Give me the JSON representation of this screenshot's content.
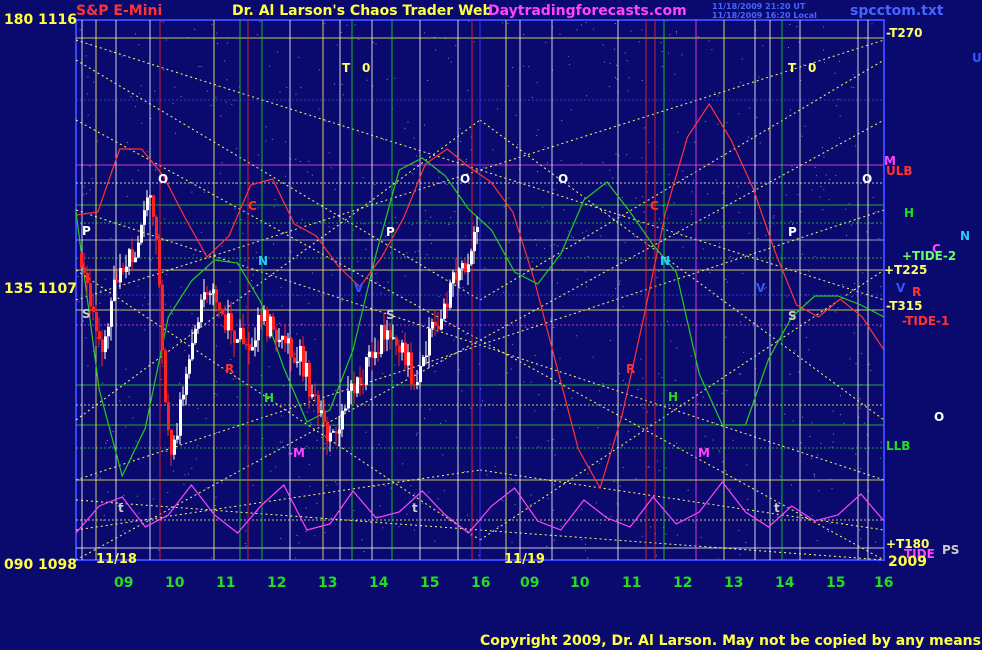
{
  "header": {
    "title_left": "S&P E-Mini",
    "title_center": "Dr. Al Larson's Chaos Trader Web",
    "website": "Daytradingforecasts.com",
    "timestamp1": "11/18/2009 21:20 UT",
    "timestamp2": "11/18/2009 16:20 Local",
    "filename": "spcctom.txt"
  },
  "copyright": "Copyright 2009, Dr. Al Larson. May not be copied by any means.",
  "y_axis": [
    {
      "angle": "180",
      "price": "1116"
    },
    {
      "angle": "135",
      "price": "1107"
    },
    {
      "angle": "090",
      "price": "1098"
    }
  ],
  "x_axis": {
    "hours": [
      {
        "h": "09",
        "x": 122
      },
      {
        "h": "10",
        "x": 173
      },
      {
        "h": "11",
        "x": 224
      },
      {
        "h": "12",
        "x": 275
      },
      {
        "h": "13",
        "x": 326
      },
      {
        "h": "14",
        "x": 377
      },
      {
        "h": "15",
        "x": 428
      },
      {
        "h": "16",
        "x": 479
      },
      {
        "h": "09",
        "x": 528
      },
      {
        "h": "10",
        "x": 578
      },
      {
        "h": "11",
        "x": 630
      },
      {
        "h": "12",
        "x": 681
      },
      {
        "h": "13",
        "x": 732
      },
      {
        "h": "14",
        "x": 783
      },
      {
        "h": "15",
        "x": 834
      },
      {
        "h": "16",
        "x": 882
      }
    ],
    "dates": [
      {
        "label": "11/18",
        "x": 96
      },
      {
        "label": "11/19",
        "x": 504
      }
    ],
    "year": "2009"
  },
  "right_labels": [
    {
      "text": "-T270",
      "color": "#ffff66",
      "x": 886,
      "y": 37
    },
    {
      "text": "M",
      "color": "#ff44ff",
      "x": 884,
      "y": 165
    },
    {
      "text": "ULB",
      "color": "#ff3333",
      "x": 886,
      "y": 175
    },
    {
      "text": "H",
      "color": "#22dd22",
      "x": 904,
      "y": 217
    },
    {
      "text": "N",
      "color": "#22ccff",
      "x": 960,
      "y": 240
    },
    {
      "text": "C",
      "color": "#ff44ff",
      "x": 932,
      "y": 253
    },
    {
      "text": "+TIDE-2",
      "color": "#66ff66",
      "x": 902,
      "y": 260
    },
    {
      "text": "+T225",
      "color": "#ffff66",
      "x": 884,
      "y": 274
    },
    {
      "text": "R",
      "color": "#ff3333",
      "x": 912,
      "y": 296
    },
    {
      "text": "-T315",
      "color": "#ffff66",
      "x": 886,
      "y": 310
    },
    {
      "text": "-TIDE-1",
      "color": "#ff3333",
      "x": 902,
      "y": 325
    },
    {
      "text": "U",
      "color": "#3355ff",
      "x": 972,
      "y": 62
    },
    {
      "text": "O",
      "color": "#ffffff",
      "x": 934,
      "y": 421
    },
    {
      "text": "LLB",
      "color": "#22dd22",
      "x": 886,
      "y": 450
    },
    {
      "text": "+T180",
      "color": "#ffff66",
      "x": 886,
      "y": 548
    },
    {
      "text": "TIDE",
      "color": "#ff44ff",
      "x": 904,
      "y": 558
    },
    {
      "text": "PS",
      "color": "#cccccc",
      "x": 942,
      "y": 554
    },
    {
      "text": "V",
      "color": "#3355ff",
      "x": 896,
      "y": 292
    }
  ],
  "chart_labels": [
    {
      "text": "T",
      "color": "#ffff66",
      "x": 342,
      "y": 72
    },
    {
      "text": "0",
      "color": "#ffff66",
      "x": 362,
      "y": 72
    },
    {
      "text": "T",
      "color": "#ffff66",
      "x": 788,
      "y": 72
    },
    {
      "text": "0",
      "color": "#ffff66",
      "x": 808,
      "y": 72
    },
    {
      "text": "O",
      "color": "#ffffff",
      "x": 158,
      "y": 183
    },
    {
      "text": "O",
      "color": "#ffffff",
      "x": 460,
      "y": 183
    },
    {
      "text": "O",
      "color": "#ffffff",
      "x": 558,
      "y": 183
    },
    {
      "text": "O",
      "color": "#ffffff",
      "x": 862,
      "y": 183
    },
    {
      "text": "C",
      "color": "#ff3333",
      "x": 248,
      "y": 210
    },
    {
      "text": "C",
      "color": "#ff3333",
      "x": 650,
      "y": 210
    },
    {
      "text": "P",
      "color": "#ffffff",
      "x": 82,
      "y": 235
    },
    {
      "text": "P",
      "color": "#ffffff",
      "x": 386,
      "y": 236
    },
    {
      "text": "P",
      "color": "#ffffff",
      "x": 788,
      "y": 236
    },
    {
      "text": "N",
      "color": "#22ccff",
      "x": 258,
      "y": 265
    },
    {
      "text": "N",
      "color": "#22ccff",
      "x": 660,
      "y": 265
    },
    {
      "text": "V",
      "color": "#3355ff",
      "x": 354,
      "y": 292
    },
    {
      "text": "V",
      "color": "#3355ff",
      "x": 756,
      "y": 292
    },
    {
      "text": "S",
      "color": "#cccccc",
      "x": 82,
      "y": 318
    },
    {
      "text": "S",
      "color": "#cccccc",
      "x": 386,
      "y": 319
    },
    {
      "text": "S",
      "color": "#cccccc",
      "x": 788,
      "y": 320
    },
    {
      "text": "R",
      "color": "#ff3333",
      "x": 225,
      "y": 373
    },
    {
      "text": "R",
      "color": "#ff3333",
      "x": 626,
      "y": 373
    },
    {
      "text": "H",
      "color": "#22dd22",
      "x": 264,
      "y": 402
    },
    {
      "text": "H",
      "color": "#22dd22",
      "x": 668,
      "y": 401
    },
    {
      "text": "-M",
      "color": "#ff44ff",
      "x": 288,
      "y": 457
    },
    {
      "text": "M",
      "color": "#ff44ff",
      "x": 698,
      "y": 457
    },
    {
      "text": "t",
      "color": "#cccccc",
      "x": 118,
      "y": 512
    },
    {
      "text": "t",
      "color": "#cccccc",
      "x": 412,
      "y": 512
    },
    {
      "text": "t",
      "color": "#cccccc",
      "x": 774,
      "y": 512
    }
  ],
  "chart_data": {
    "type": "candlestick",
    "instrument": "S&P E-Mini",
    "ylim": [
      1098,
      1116
    ],
    "y_ticks": [
      1098,
      1107,
      1116
    ],
    "x_days": [
      "11/18",
      "11/19"
    ],
    "series": [
      {
        "color": "#ff3333",
        "values": [
          1109.5,
          1109.6,
          1111.7,
          1111.7,
          1110.8,
          1109.4,
          1108.1,
          1108.8,
          1110.5,
          1110.7,
          1109.2,
          1108.8,
          1107.8,
          1107.1,
          1108.1,
          1109.4,
          1111.2,
          1111.7,
          1111.1,
          1110.6,
          1109.6,
          1107.3,
          1104.5,
          1101.7,
          1100.4,
          1102.8,
          1106.1,
          1109.6,
          1112.1,
          1113.2,
          1112.0,
          1110.4,
          1108.3,
          1106.5,
          1106.1,
          1106.7,
          1106.1,
          1105.0
        ]
      },
      {
        "color": "#22cc22",
        "values": [
          1109.6,
          1103.7,
          1100.8,
          1102.4,
          1106.1,
          1107.3,
          1108.0,
          1107.9,
          1106.6,
          1104.4,
          1102.6,
          1103.0,
          1105.0,
          1108.2,
          1111.0,
          1111.4,
          1110.8,
          1109.7,
          1109.0,
          1107.6,
          1107.2,
          1108.2,
          1110.0,
          1110.6,
          1109.6,
          1108.5,
          1107.6,
          1104.2,
          1102.5,
          1102.5,
          1104.7,
          1106.1,
          1106.8,
          1106.8,
          1106.5,
          1106.1
        ]
      },
      {
        "color": "#ff44ff",
        "values": [
          1098.9,
          1099.8,
          1100.1,
          1099.1,
          1099.5,
          1100.5,
          1099.5,
          1098.9,
          1099.8,
          1100.5,
          1099.0,
          1099.2,
          1100.3,
          1099.4,
          1099.6,
          1100.3,
          1099.5,
          1098.9,
          1099.8,
          1100.4,
          1099.3,
          1099.0,
          1100.0,
          1099.4,
          1099.1,
          1100.1,
          1099.2,
          1099.6,
          1100.6,
          1099.6,
          1099.1,
          1099.8,
          1099.3,
          1099.5,
          1100.2,
          1099.3
        ]
      }
    ]
  },
  "colors": {
    "background": "#0a0a6e",
    "plot_border": "#3a44ff",
    "dotted_grid": "#ffff66",
    "bull_candle": "#ffffff",
    "bear_candle": "#ff2222"
  }
}
